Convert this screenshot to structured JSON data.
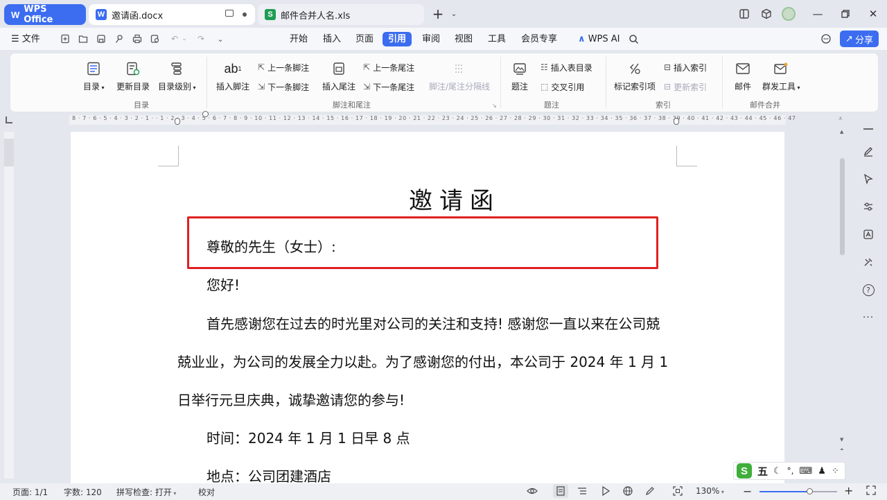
{
  "tabs": {
    "home": "WPS Office",
    "doc": "邀请函.docx",
    "xls": "邮件合并人名.xls",
    "doc_badge": "W",
    "xls_badge": "S"
  },
  "menu": {
    "file": "文件",
    "items": [
      "开始",
      "插入",
      "页面",
      "引用",
      "审阅",
      "视图",
      "工具",
      "会员专享"
    ],
    "active": "引用",
    "wps_ai": "WPS AI",
    "share": "分享"
  },
  "ribbon": {
    "toc": "目录",
    "update_toc": "更新目录",
    "toc_level": "目录级别",
    "insert_footnote": "插入脚注",
    "prev_footnote": "上一条脚注",
    "next_footnote": "下一条脚注",
    "insert_endnote": "插入尾注",
    "prev_endnote": "上一条尾注",
    "next_endnote": "下一条尾注",
    "separator_line": "脚注/尾注分隔线",
    "caption": "题注",
    "insert_figure_toc": "插入表目录",
    "cross_ref": "交叉引用",
    "mark_index": "标记索引项",
    "insert_index": "插入索引",
    "update_index": "更新索引",
    "mail": "邮件",
    "mass_tool": "群发工具",
    "groups": {
      "toc": "目录",
      "footnote": "脚注和尾注",
      "caption": "题注",
      "index": "索引",
      "mailmerge": "邮件合并"
    }
  },
  "ruler": "8 · 7 · 6 · 5 · 4 · 3 · 2 · 1 · · 1 · 2 · 3 · 4 · 5 · 6 · 7 · 8 · 9 · 10 · 11 · 12 · 13 · 14 · 15 · 16 · 17 · 18 · 19 · 20 · 21 · 22 · 23 · 24 · 25 · 26 · 27 · 28 · 29 · 30 · 31 · 32 · 33 · 34 · 35 · 36 · 37 · 38 · 39 · 40 · 41 · 42 · 43 · 44 · 45 · 46 · 47",
  "document": {
    "title": "邀请函",
    "salutation": "尊敬的先生（女士）:",
    "greeting": "您好!",
    "body1": "首先感谢您在过去的时光里对公司的关注和支持! 感谢您一直以来在公司兢",
    "body2": "兢业业，为公司的发展全力以赴。为了感谢您的付出，本公司于 2024 年 1 月 1",
    "body3": "日举行元旦庆典，诚挚邀请您的参与!",
    "time": "时间：2024 年 1 月 1 日早 8 点",
    "place": "地点：公司团建酒店"
  },
  "ime": {
    "logo": "S",
    "mode": "五"
  },
  "status": {
    "page": "页面: 1/1",
    "words": "字数: 120",
    "spell": "拼写检查: 打开",
    "proof": "校对",
    "zoom": "130%"
  },
  "zoom_level": 0.65
}
